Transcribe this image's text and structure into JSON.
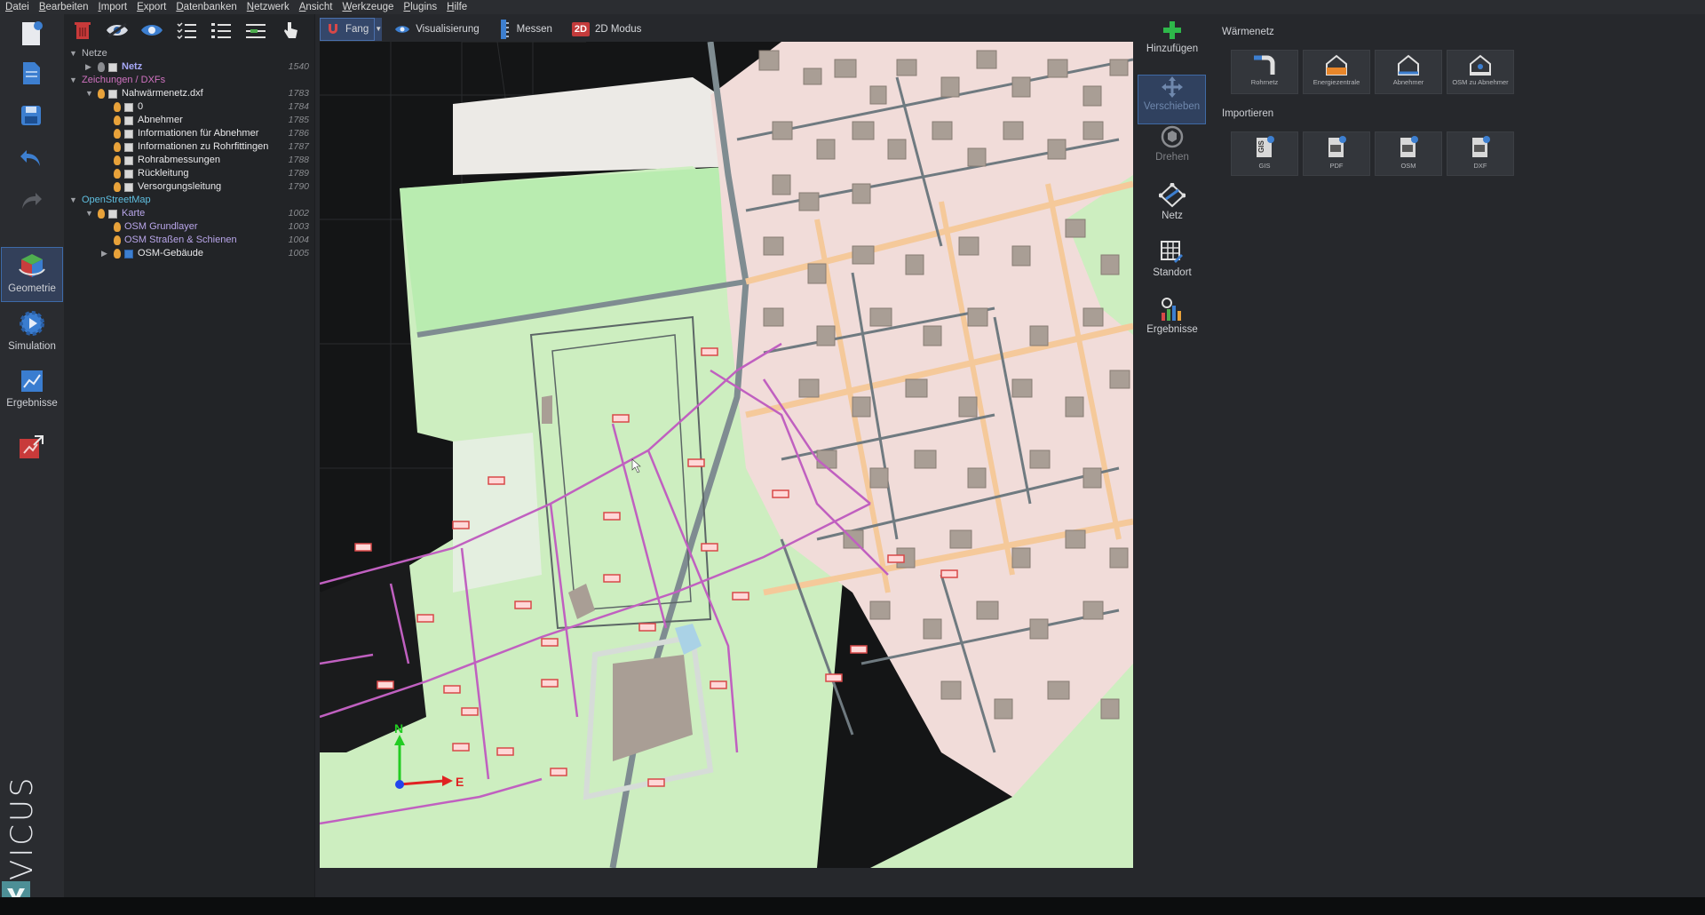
{
  "menubar": [
    "Datei",
    "Bearbeiten",
    "Import",
    "Export",
    "Datenbanken",
    "Netzwerk",
    "Ansicht",
    "Werkzeuge",
    "Plugins",
    "Hilfe"
  ],
  "rail": {
    "geometry_label": "Geometrie",
    "simulation_label": "Simulation",
    "results_label": "Ergebnisse",
    "brand": "VICUS"
  },
  "tree": {
    "rows": [
      {
        "label": "Netze",
        "num": "",
        "color": "group"
      },
      {
        "label": "Netz",
        "num": "1540",
        "color": "bold"
      },
      {
        "label": "Zeichungen / DXFs",
        "num": "",
        "color": "pink"
      },
      {
        "label": "Nahwärmenetz.dxf",
        "num": "1783",
        "color": "white"
      },
      {
        "label": "0",
        "num": "1784",
        "color": "white"
      },
      {
        "label": "Abnehmer",
        "num": "1785",
        "color": "white"
      },
      {
        "label": "Informationen für Abnehmer",
        "num": "1786",
        "color": "white"
      },
      {
        "label": "Informationen zu Rohrfittingen",
        "num": "1787",
        "color": "white"
      },
      {
        "label": "Rohrabmessungen",
        "num": "1788",
        "color": "white"
      },
      {
        "label": "Rückleitung",
        "num": "1789",
        "color": "white"
      },
      {
        "label": "Versorgungsleitung",
        "num": "1790",
        "color": "white"
      },
      {
        "label": "OpenStreetMap",
        "num": "",
        "color": "cyan"
      },
      {
        "label": "Karte",
        "num": "1002",
        "color": "lav"
      },
      {
        "label": "OSM Grundlayer",
        "num": "1003",
        "color": "lav"
      },
      {
        "label": "OSM Straßen & Schienen",
        "num": "1004",
        "color": "lav"
      },
      {
        "label": "OSM-Gebäude",
        "num": "1005",
        "color": "white"
      }
    ]
  },
  "vtoolbar": {
    "snap": "Fang",
    "visualization": "Visualisierung",
    "measure": "Messen",
    "mode2d": "2D Modus",
    "mode2d_badge": "2D"
  },
  "viewport": {
    "axis_north": "N",
    "axis_east": "E"
  },
  "rtools": {
    "add": "Hinzufügen",
    "move": "Verschieben",
    "rotate": "Drehen",
    "network": "Netz",
    "location": "Standort",
    "results": "Ergebnisse"
  },
  "props": {
    "section1": "Wärmenetz",
    "cards1": [
      "Rohrnetz",
      "Energiezentrale",
      "Abnehmer",
      "OSM zu Abnehmer"
    ],
    "section2": "Importieren",
    "cards2": [
      "GIS",
      "PDF",
      "OSM",
      "DXF"
    ]
  },
  "colors": {
    "accent": "#3d6aa8",
    "network": "#c060c0",
    "map_green": "#c8ecb0",
    "map_pink": "#f0dcd8",
    "building": "#a99e95"
  }
}
